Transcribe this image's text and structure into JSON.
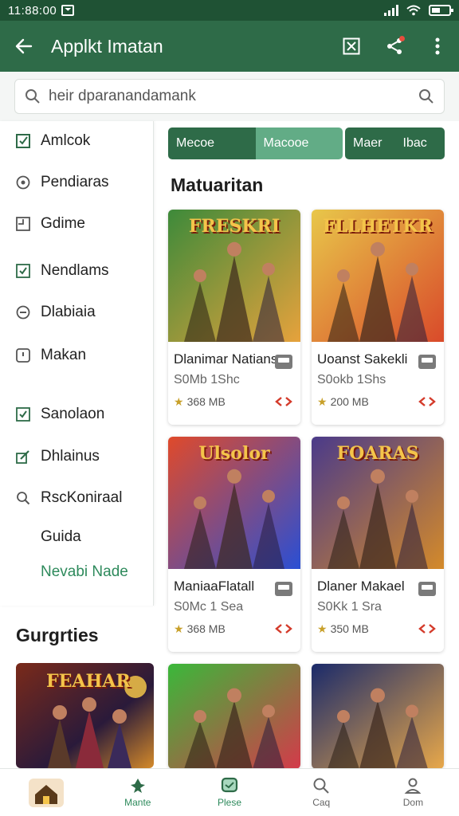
{
  "status_bar": {
    "time": "11:88:00"
  },
  "app_bar": {
    "title": "Applkt Imatan",
    "back_icon": "back-arrow-icon",
    "actions": [
      "bookmark-x-icon",
      "share-icon",
      "more-vert-icon"
    ]
  },
  "search": {
    "placeholder": "heir dparanandamank"
  },
  "sidebar": {
    "items": [
      {
        "label": "Amlcok",
        "icon": "checkbox-edit-icon"
      },
      {
        "label": "Pendiaras",
        "icon": "circle-icon"
      },
      {
        "label": "Gdime",
        "icon": "square-icon"
      },
      {
        "label": "Nendlams",
        "icon": "checkbox-icon"
      },
      {
        "label": "Dlabiaia",
        "icon": "circle-minus-icon"
      },
      {
        "label": "Makan",
        "icon": "note-icon"
      },
      {
        "label": "Sanolaon",
        "icon": "checkbox-icon"
      },
      {
        "label": "Dhlainus",
        "icon": "edit-icon"
      },
      {
        "label": "RscKoniraal",
        "icon": "search-icon"
      },
      {
        "label": "Guida"
      },
      {
        "label": "Nevabi Nade"
      }
    ]
  },
  "segments": {
    "group1": [
      "Mecoe",
      "Macooe"
    ],
    "group2": [
      "Maer",
      "Ibac"
    ]
  },
  "main": {
    "section_title": "Matuaritan",
    "games": [
      {
        "name": "Dlanimar Natians",
        "sub": "S0Mb 1Shc",
        "size": "368 MB",
        "art_title": "FRESKRI",
        "palette": [
          "#3d8a3a",
          "#e6a23c"
        ]
      },
      {
        "name": "Uoanst Sakekli",
        "sub": "S0okb 1Shs",
        "size": "200 MB",
        "art_title": "FLLHETKR",
        "palette": [
          "#e8c74a",
          "#d94a2a"
        ]
      },
      {
        "name": "ManiaaFlatall",
        "sub": "S0Mc 1 Sea",
        "size": "368 MB",
        "art_title": "Ulsolor",
        "palette": [
          "#e04a2a",
          "#2a4fd4"
        ]
      },
      {
        "name": "Dlaner Makael",
        "sub": "S0Kk 1 Sra",
        "size": "350 MB",
        "art_title": "FOARAS",
        "palette": [
          "#4a3a8a",
          "#d48a2a"
        ]
      }
    ],
    "more_games": [
      {
        "palette": [
          "#3ab83a",
          "#d43a4a"
        ]
      },
      {
        "palette": [
          "#1a2a6a",
          "#e8a84a"
        ]
      }
    ]
  },
  "categories": {
    "title": "Gurgrties",
    "card_art_title": "FEAHAR"
  },
  "bottom_nav": [
    {
      "label": "",
      "icon": "home-logo"
    },
    {
      "label": "Mante",
      "icon": "leaf-icon"
    },
    {
      "label": "Plese",
      "icon": "chat-icon"
    },
    {
      "label": "Caq",
      "icon": "search-icon"
    },
    {
      "label": "Dom",
      "icon": "profile-icon"
    }
  ],
  "colors": {
    "primary": "#2e6b48",
    "status": "#1f5234",
    "accent": "#62ac86",
    "link": "#2e8a5c"
  }
}
